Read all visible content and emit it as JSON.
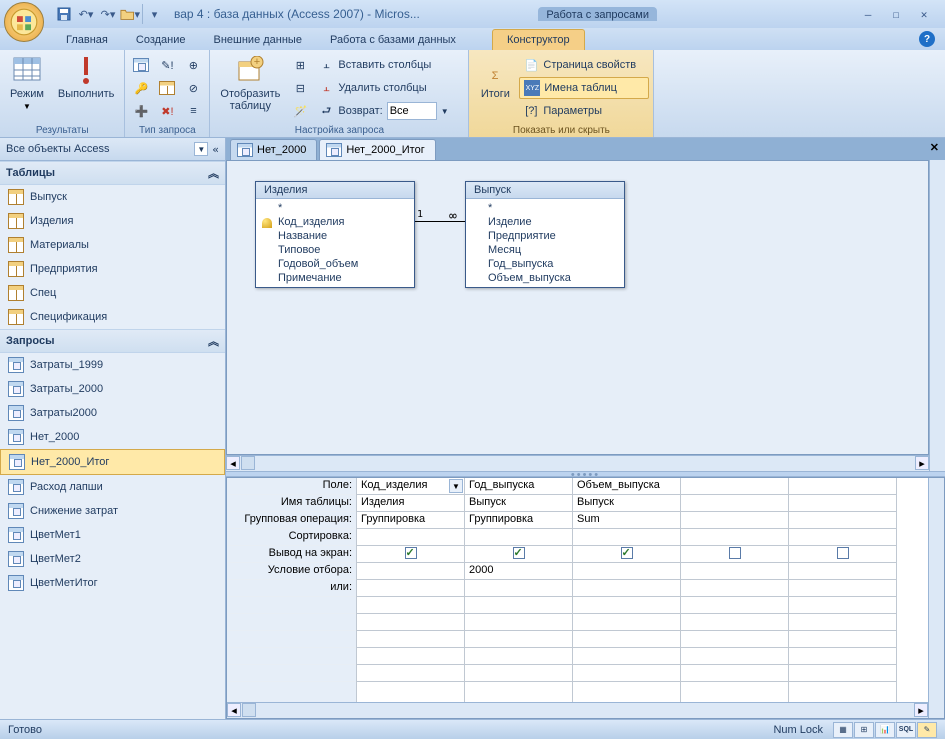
{
  "title": "вар 4 : база данных (Access 2007) - Micros...",
  "context_group_label": "Работа с запросами",
  "ribbon_tabs": {
    "home": "Главная",
    "create": "Создание",
    "external": "Внешние данные",
    "dbtools": "Работа с базами данных",
    "designer": "Конструктор"
  },
  "ribbon": {
    "results": {
      "label": "Результаты",
      "view": "Режим",
      "run": "Выполнить"
    },
    "query_type": {
      "label": "Тип запроса"
    },
    "setup": {
      "label": "Настройка запроса",
      "show_table": "Отобразить\nтаблицу",
      "insert_cols": "Вставить столбцы",
      "delete_cols": "Удалить столбцы",
      "return": "Возврат:",
      "return_val": "Все"
    },
    "showhide": {
      "label": "Показать или скрыть",
      "totals": "Итоги",
      "prop_page": "Страница свойств",
      "table_names": "Имена таблиц",
      "params": "Параметры"
    }
  },
  "nav": {
    "title": "Все объекты Access",
    "tables_hdr": "Таблицы",
    "queries_hdr": "Запросы",
    "tables": [
      "Выпуск",
      "Изделия",
      "Материалы",
      "Предприятия",
      "Спец",
      "Спецификация"
    ],
    "queries": [
      "Затраты_1999",
      "Затраты_2000",
      "Затраты2000",
      "Нет_2000",
      "Нет_2000_Итог",
      "Расход лапши",
      "Снижение затрат",
      "ЦветМет1",
      "ЦветМет2",
      "ЦветМетИтог"
    ],
    "selected": "Нет_2000_Итог"
  },
  "doc_tabs": {
    "t1": "Нет_2000",
    "t2": "Нет_2000_Итог"
  },
  "tables_in_design": {
    "t1": {
      "title": "Изделия",
      "fields": [
        "*",
        "Код_изделия",
        "Название",
        "Типовое",
        "Годовой_объем",
        "Примечание"
      ],
      "key_index": 1
    },
    "t2": {
      "title": "Выпуск",
      "fields": [
        "*",
        "Изделие",
        "Предприятие",
        "Месяц",
        "Год_выпуска",
        "Объем_выпуска"
      ]
    }
  },
  "rel": {
    "left": "1",
    "right": "∞"
  },
  "grid_labels": {
    "field": "Поле:",
    "table": "Имя таблицы:",
    "group": "Групповая операция:",
    "sort": "Сортировка:",
    "show": "Вывод на экран:",
    "criteria": "Условие отбора:",
    "or": "или:"
  },
  "grid_cols": [
    {
      "field": "Код_изделия",
      "table": "Изделия",
      "group": "Группировка",
      "show": true,
      "criteria": "",
      "active": true
    },
    {
      "field": "Год_выпуска",
      "table": "Выпуск",
      "group": "Группировка",
      "show": true,
      "criteria": "2000"
    },
    {
      "field": "Объем_выпуска",
      "table": "Выпуск",
      "group": "Sum",
      "show": true,
      "criteria": ""
    },
    {
      "field": "",
      "table": "",
      "group": "",
      "show": false,
      "criteria": ""
    },
    {
      "field": "",
      "table": "",
      "group": "",
      "show": false,
      "criteria": ""
    }
  ],
  "status": {
    "ready": "Готово",
    "numlock": "Num Lock"
  }
}
